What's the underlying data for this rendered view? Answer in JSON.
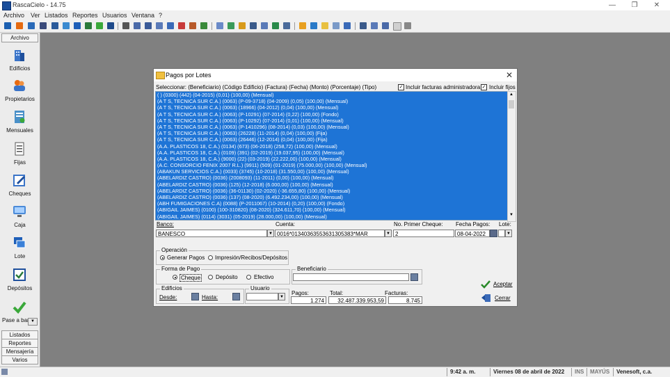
{
  "window": {
    "title": "RascaCielo - 14.75"
  },
  "menu": [
    "Archivo",
    "Ver",
    "Listados",
    "Reportes",
    "Usuarios",
    "Ventana",
    "?"
  ],
  "sidebar": {
    "header": "Archivo",
    "items": [
      {
        "label": "Edificios",
        "icon": "buildings-icon",
        "color": "#3a74c8"
      },
      {
        "label": "Propietarios",
        "icon": "people-icon",
        "color": "#e86a10"
      },
      {
        "label": "Mensuales",
        "icon": "monthly-doc-icon",
        "color": "#4a90c8"
      },
      {
        "label": "Fijas",
        "icon": "fixed-doc-icon",
        "color": "#8a8a8a"
      },
      {
        "label": "Cheques",
        "icon": "check-pen-icon",
        "color": "#3a74c8"
      },
      {
        "label": "Caja",
        "icon": "monitor-icon",
        "color": "#4a8ad8"
      },
      {
        "label": "Lote",
        "icon": "batch-icon",
        "color": "#1e5fb8"
      },
      {
        "label": "Depósitos",
        "icon": "deposit-check-icon",
        "color": "#2a7a3a"
      },
      {
        "label": "Pase a bar",
        "icon": "checkmark-icon",
        "color": "#3aa83a"
      }
    ],
    "bottom": [
      "Listados",
      "Reportes",
      "Mensajería",
      "Varios"
    ]
  },
  "dialog": {
    "title": "Pagos por Lotes",
    "select_label": "Seleccionar: (Beneficiario) (Código Edificio) (Factura) (Fecha) (Monto) (Porcentaje) (Tipo)",
    "include_admin_label": "Incluir facturas administradora",
    "include_fixed_label": "Incluir fijos",
    "rows": [
      "( ) (0300) (442) (04-2015) (0,01) (100,00) (Mensual)",
      "(A T S, TECNICA SUR C.A.) (0063) (P-09-3718) (04-2009) (0,05) (100,00) (Mensual)",
      "(A T S, TECNICA SUR C.A.) (0063) (18966) (04-2012) (0,04) (100,00) (Mensual)",
      "(A T S, TECNICA SUR C.A.) (0063) (P-10291) (07-2014) (0,22) (100,00) (Fondo)",
      "(A T S, TECNICA SUR C.A.) (0063) (P-10292) (07-2014) (0,01) (100,00) (Mensual)",
      "(A T S, TECNICA SUR C.A.) (0063) (P-1410296) (08-2014) (0,03) (100,00) (Mensual)",
      "(A T S, TECNICA SUR C.A.) (0063) (26228) (11-2014) (0,04) (100,00) (Fija)",
      "(A T S, TECNICA SUR C.A.) (0063) (26446) (12-2014) (0,04) (100,00) (Fija)",
      "(A.A. PLASTICOS 18, C.A.) (0134) (673) (06-2018) (258,72) (100,00) (Mensual)",
      "(A.A. PLASTICOS 18, C.A.) (0109) (391) (02-2019) (19.037,95) (100,00) (Mensual)",
      "(A.A. PLASTICOS 18, C.A.) (9000) (22) (03-2019) (22.222,00) (100,00) (Mensual)",
      "(A.C. CONSORCIO FENIX 2007 R.L.) (9911) (509) (01-2019) (75.000,00) (100,00) (Mensual)",
      "(ABAKUN SERVICIOS C.A.) (0033) (3745) (10-2018) (31.550,00) (100,00) (Mensual)",
      "(ABELARDIZ CASTRO) (0036) (2008093) (11-2011) (0,00) (100,00) (Mensual)",
      "(ABELARDIZ CASTRO) (0036) (125) (12-2018) (6.000,00) (100,00) (Mensual)",
      "(ABELARDIZ CASTRO) (0036) (36-01130) (02-2020) (-36.655,80) (100,00) (Mensual)",
      "(ABELARDIZ CASTRO) (0036) (137) (08-2020) (6.492.234,00) (100,00) (Mensual)",
      "(ABH FUMIGACIONES C.A) (0088) (P-2011067) (10-2014) (0,20) (100,00) (Fondo)",
      "(ABIGAIL JAIMES) (0100) (100-310820) (08-2020) (324.611,70) (100,00) (Mensual)",
      "(ABIGAIL JAIMES) (0114) (3031) (05-2019) (28.000,00) (100,00) (Mensual)"
    ],
    "banco_label": "Banco:",
    "banco_value": "BANESCO",
    "cuenta_label": "Cuenta:",
    "cuenta_value": "0016*01340363553631305383*MAR",
    "primer_cheque_label": "No. Primer Cheque:",
    "primer_cheque_value": "2",
    "fecha_pagos_label": "Fecha Pagos:",
    "fecha_pagos_value": "08-04-2022",
    "lote_label": "Lote:",
    "lote_value": "",
    "operacion_label": "Operación",
    "op_generar": "Generar Pagos",
    "op_impresion": "Impresión/Recibos/Depósitos",
    "forma_pago_label": "Forma de Pago",
    "fp_cheque": "Cheque",
    "fp_deposito": "Depósito",
    "fp_efectivo": "Efectivo",
    "beneficiario_label": "Beneficiario",
    "edificios_label": "Edificios",
    "desde_label": "Desde:",
    "hasta_label": "Hasta:",
    "usuario_label": "Usuario",
    "pagos_label": "Pagos:",
    "pagos_value": "1.274",
    "total_label": "Total:",
    "total_value": "32.487.339.953,59",
    "facturas_label": "Facturas:",
    "facturas_value": "8.745",
    "aceptar_label": "Aceptar",
    "cerrar_label": "Cerrar"
  },
  "statusbar": {
    "time": "9:42 a. m.",
    "date": "Viernes 08 de abril de 2022",
    "ins": "INS",
    "mayus": "MAYÚS",
    "company": "Venesoft, c.a."
  },
  "colors": {
    "selection": "#1e74d6",
    "desktop": "#808080"
  }
}
